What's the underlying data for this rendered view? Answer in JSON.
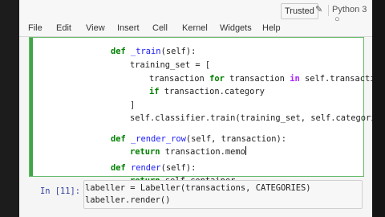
{
  "header": {
    "trusted_label": "Trusted",
    "pencil_icon": "pencil-icon",
    "kernel_label": "Python 3",
    "kernel_indicator": "circle-icon"
  },
  "menu": {
    "items": [
      "File",
      "Edit",
      "View",
      "Insert",
      "Cell",
      "Kernel",
      "Widgets",
      "Help"
    ]
  },
  "cell1": {
    "lines": [
      {
        "kw": "def ",
        "fn": "_train",
        "rest": "(self):"
      },
      {
        "text": "training_set = ["
      },
      {
        "pre": "transaction ",
        "kw1": "for",
        "mid": " transaction ",
        "op": "in",
        "post": " self.transactions"
      },
      {
        "kw": "if",
        "rest": " transaction.category"
      },
      {
        "text": "]"
      },
      {
        "text": "self.classifier.train(training_set, self.categories)"
      },
      {
        "kw": "def ",
        "fn": "_render_row",
        "rest": "(self, transaction):"
      },
      {
        "kw": "return",
        "rest": " transaction.memo"
      },
      {
        "kw": "def ",
        "fn": "render",
        "rest": "(self):"
      },
      {
        "kw": "return",
        "rest": " self.container"
      }
    ]
  },
  "cell2": {
    "prompt": "In [11]:",
    "lines": [
      "labeller = Labeller(transactions, CATEGORIES)",
      "labeller.render()"
    ]
  },
  "colors": {
    "keyword": "#008000",
    "function_name": "#1a1aff",
    "operator_in": "#aa22ff",
    "selected_cell_border": "#66bb6a",
    "prompt": "#303f9f"
  }
}
